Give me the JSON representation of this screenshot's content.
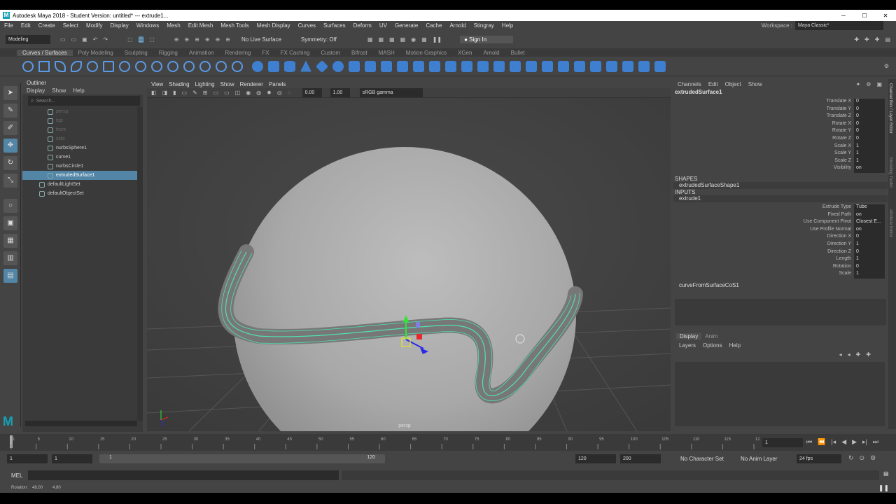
{
  "window": {
    "title": "Autodesk Maya 2018 - Student Version: untitled*   ---   extrude1...",
    "minimize": "─",
    "maximize": "☐",
    "close": "✕"
  },
  "menubar": [
    "File",
    "Edit",
    "Create",
    "Select",
    "Modify",
    "Display",
    "Windows",
    "Mesh",
    "Edit Mesh",
    "Mesh Tools",
    "Mesh Display",
    "Curves",
    "Surfaces",
    "Deform",
    "UV",
    "Generate",
    "Cache",
    "Arnold",
    "Stingray",
    "Help"
  ],
  "workspace": {
    "label": "Workspace :",
    "value": "Maya Classic*"
  },
  "statusline": {
    "mode": "Modeling",
    "live_surface": "No Live Surface",
    "symmetry": "Symmetry: Off",
    "sign_in": "Sign In"
  },
  "shelf_tabs": [
    "Curves / Surfaces",
    "Poly Modeling",
    "Sculpting",
    "Rigging",
    "Animation",
    "Rendering",
    "FX",
    "FX Caching",
    "Custom",
    "Bifrost",
    "MASH",
    "Motion Graphics",
    "XGen",
    "Arnold",
    "Bullet"
  ],
  "outliner": {
    "title": "Outliner",
    "menu": [
      "Display",
      "Show",
      "Help"
    ],
    "search_placeholder": "Search...",
    "items": [
      {
        "label": "persp",
        "state": "dim"
      },
      {
        "label": "top",
        "state": "dim"
      },
      {
        "label": "front",
        "state": "dim"
      },
      {
        "label": "side",
        "state": "dim"
      },
      {
        "label": "nurbsSphere1",
        "state": "normal"
      },
      {
        "label": "curve1",
        "state": "normal"
      },
      {
        "label": "nurbsCircle1",
        "state": "normal"
      },
      {
        "label": "extrudedSurface1",
        "state": "selected"
      },
      {
        "label": "defaultLightSet",
        "state": "normal"
      },
      {
        "label": "defaultObjectSet",
        "state": "normal"
      }
    ]
  },
  "viewport": {
    "menu": [
      "View",
      "Shading",
      "Lighting",
      "Show",
      "Renderer",
      "Panels"
    ],
    "exposure": "0.00",
    "gamma": "1.00",
    "colorspace": "sRGB gamma",
    "camera_label": "persp"
  },
  "channelbox": {
    "menu": [
      "Channels",
      "Edit",
      "Object",
      "Show"
    ],
    "object": "extrudedSurface1",
    "attributes": [
      {
        "label": "Translate X",
        "value": "0"
      },
      {
        "label": "Translate Y",
        "value": "0"
      },
      {
        "label": "Translate Z",
        "value": "0"
      },
      {
        "label": "Rotate X",
        "value": "0"
      },
      {
        "label": "Rotate Y",
        "value": "0"
      },
      {
        "label": "Rotate Z",
        "value": "0"
      },
      {
        "label": "Scale X",
        "value": "1"
      },
      {
        "label": "Scale Y",
        "value": "1"
      },
      {
        "label": "Scale Z",
        "value": "1"
      },
      {
        "label": "Visibility",
        "value": "on"
      }
    ],
    "shapes_header": "SHAPES",
    "shape_name": "extrudedSurfaceShape1",
    "inputs_header": "INPUTS",
    "input_name": "extrude1",
    "input_attributes": [
      {
        "label": "Extrude Type",
        "value": "Tube"
      },
      {
        "label": "Fixed Path",
        "value": "on"
      },
      {
        "label": "Use Component Pivot",
        "value": "Closest E..."
      },
      {
        "label": "Use Profile Normal",
        "value": "on"
      },
      {
        "label": "Direction X",
        "value": "0"
      },
      {
        "label": "Direction Y",
        "value": "1"
      },
      {
        "label": "Direction Z",
        "value": "0"
      },
      {
        "label": "Length",
        "value": "1"
      },
      {
        "label": "Rotation",
        "value": "0"
      },
      {
        "label": "Scale",
        "value": "1"
      }
    ],
    "second_input": "curveFromSurfaceCoS1"
  },
  "side_tabs": [
    "Channel Box / Layer Editor",
    "Modeling Toolkit",
    "Attribute Editor"
  ],
  "layer_panel": {
    "tabs": [
      "Display",
      "Anim"
    ],
    "menu": [
      "Layers",
      "Options",
      "Help"
    ]
  },
  "timeline": {
    "ticks": [
      "1",
      "5",
      "10",
      "15",
      "20",
      "25",
      "30",
      "35",
      "40",
      "45",
      "50",
      "55",
      "60",
      "65",
      "70",
      "75",
      "80",
      "85",
      "90",
      "95",
      "100",
      "105",
      "110",
      "115",
      "120"
    ],
    "current_frame": "1"
  },
  "range": {
    "start": "1",
    "range_start": "1",
    "slider_start": "1",
    "slider_end": "120",
    "range_end": "120",
    "end": "200",
    "character_set": "No Character Set",
    "anim_layer": "No Anim Layer",
    "fps": "24 fps"
  },
  "cmdline": {
    "label": "MEL"
  },
  "helpline": {
    "text": "Rotation:",
    "v1": "48.00",
    "v2": "4.80"
  },
  "colors": {
    "accent": "#5285a6",
    "curve": "#4fe2b0",
    "tool_blue": "#3f7fd0"
  }
}
